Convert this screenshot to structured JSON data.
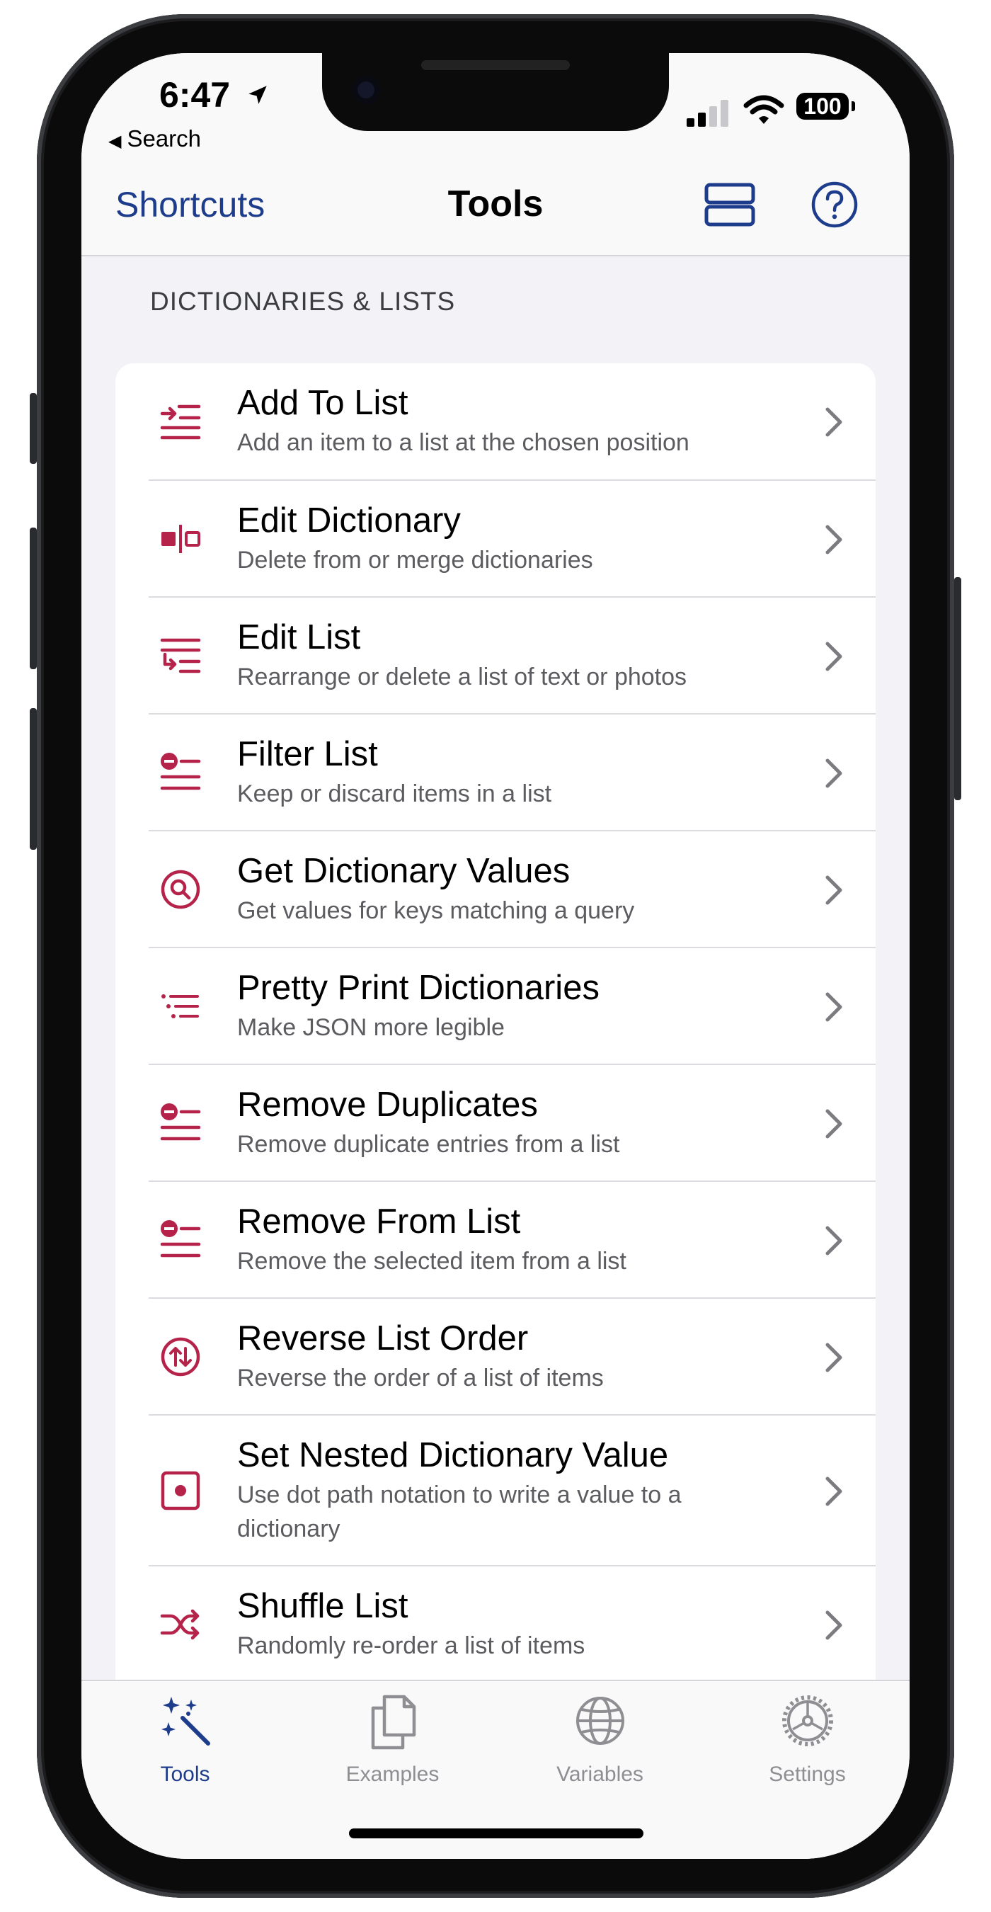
{
  "status_bar": {
    "time": "6:47",
    "back_label": "Search",
    "battery": "100"
  },
  "nav": {
    "back_label": "Shortcuts",
    "title": "Tools"
  },
  "section": {
    "header": "DICTIONARIES & LISTS"
  },
  "items": [
    {
      "title": "Add To List",
      "subtitle": "Add an item to a list at the chosen position",
      "icon": "list-add-icon"
    },
    {
      "title": "Edit Dictionary",
      "subtitle": "Delete from or merge dictionaries",
      "icon": "dictionary-icon"
    },
    {
      "title": "Edit List",
      "subtitle": "Rearrange or delete a list of text or photos",
      "icon": "list-edit-icon"
    },
    {
      "title": "Filter List",
      "subtitle": "Keep or discard items in a list",
      "icon": "list-remove-icon"
    },
    {
      "title": "Get Dictionary Values",
      "subtitle": "Get values for keys matching a query",
      "icon": "search-circle-icon"
    },
    {
      "title": "Pretty Print Dictionaries",
      "subtitle": "Make JSON more legible",
      "icon": "indent-list-icon"
    },
    {
      "title": "Remove Duplicates",
      "subtitle": "Remove duplicate entries from a list",
      "icon": "list-remove-icon"
    },
    {
      "title": "Remove From List",
      "subtitle": "Remove the selected item from a list",
      "icon": "list-remove-icon"
    },
    {
      "title": "Reverse List Order",
      "subtitle": "Reverse the order of a list of items",
      "icon": "reverse-arrows-icon"
    },
    {
      "title": "Set Nested Dictionary Value",
      "subtitle": "Use dot path notation to write a value to a dictionary",
      "icon": "dot-square-icon"
    },
    {
      "title": "Shuffle List",
      "subtitle": "Randomly re-order a list of items",
      "icon": "shuffle-icon"
    }
  ],
  "tabs": [
    {
      "label": "Tools",
      "icon": "magic-wand-icon",
      "active": true
    },
    {
      "label": "Examples",
      "icon": "documents-icon",
      "active": false
    },
    {
      "label": "Variables",
      "icon": "globe-icon",
      "active": false
    },
    {
      "label": "Settings",
      "icon": "gear-icon",
      "active": false
    }
  ],
  "colors": {
    "accent": "#1e3c8c",
    "icon": "#b5234a",
    "background": "#f2f2f7",
    "inactive_tab": "#8e8e93"
  }
}
